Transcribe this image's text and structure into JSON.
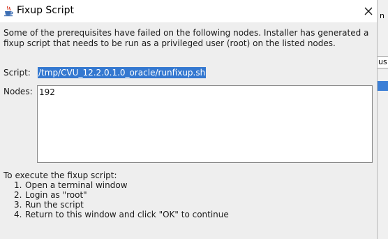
{
  "window": {
    "title": "Fixup Script",
    "icon": "java-cup-icon",
    "close_glyph": "✕"
  },
  "message": "Some of the prerequisites have failed on the following nodes. Installer has generated a fixup script that needs to be run as a privileged user (root) on the listed nodes.",
  "script": {
    "label": "Script:",
    "path": "/tmp/CVU_12.2.0.1.0_oracle/runfixup.sh"
  },
  "nodes": {
    "label": "Nodes:",
    "value": "192"
  },
  "instructions": {
    "intro": "To execute the fixup script:",
    "steps": [
      {
        "num": "1.",
        "text": "Open a terminal window"
      },
      {
        "num": "2.",
        "text": "Login as \"root\""
      },
      {
        "num": "3.",
        "text": "Run the script"
      },
      {
        "num": "4.",
        "text": "Return to this window and click \"OK\" to continue"
      }
    ]
  },
  "background_app": {
    "fragment_top": "n",
    "fragment_field": "us"
  },
  "colors": {
    "selection": "#3478d0",
    "dialog_bg": "#eeeeee",
    "titlebar_bg": "#ffffff"
  }
}
